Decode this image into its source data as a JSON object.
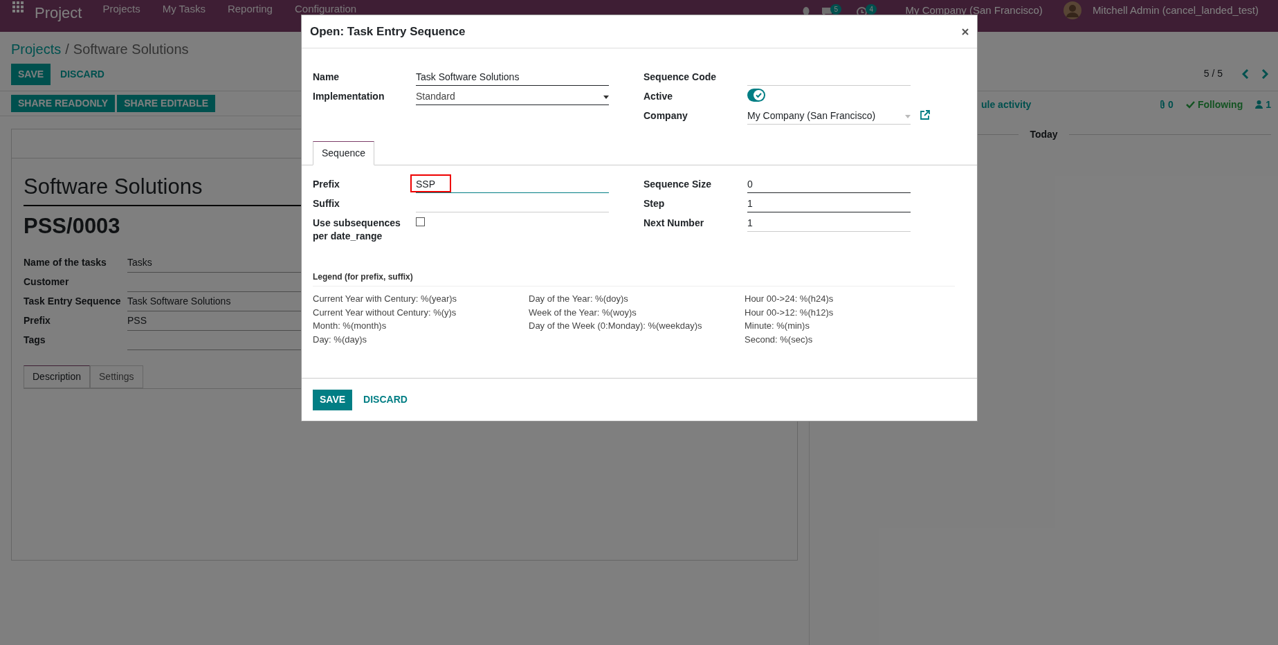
{
  "navbar": {
    "app_title": "Project",
    "menus": [
      "Projects",
      "My Tasks",
      "Reporting",
      "Configuration"
    ],
    "notifications": [
      {
        "kind": "chat",
        "count": "5"
      },
      {
        "kind": "activity",
        "count": "4"
      }
    ],
    "company": "My Company (San Francisco)",
    "user": "Mitchell Admin (cancel_landed_test)"
  },
  "breadcrumb": {
    "parent": "Projects",
    "separator": "/",
    "current": "Software Solutions"
  },
  "form_buttons": [
    "SAVE",
    "DISCARD"
  ],
  "share_buttons": [
    "SHARE READONLY",
    "SHARE EDITABLE"
  ],
  "pager": "5 / 5",
  "chatter": {
    "activity": "ule activity",
    "attachments": "0",
    "follow": "Following",
    "followers": "1",
    "date_separator": "Today"
  },
  "record": {
    "name": "Software Solutions",
    "code": "PSS/0003",
    "fields": [
      {
        "label": "Name of the tasks",
        "value": "Tasks"
      },
      {
        "label": "Customer"
      },
      {
        "label": "Task Entry Sequence",
        "value": "Task Software Solutions"
      },
      {
        "label": "Prefix",
        "value": "PSS"
      },
      {
        "label": "Tags"
      }
    ],
    "tabs": [
      {
        "label": "Description",
        "selected": true
      },
      {
        "label": "Settings",
        "selected": false
      }
    ]
  },
  "modal": {
    "title": "Open: Task Entry Sequence",
    "fields_left": [
      {
        "kind": "text",
        "label": "Name",
        "value": "Task Software Solutions"
      },
      {
        "kind": "select",
        "label": "Implementation",
        "value": "Standard"
      }
    ],
    "fields_right": [
      {
        "kind": "text",
        "label": "Sequence Code"
      },
      {
        "kind": "toggle",
        "label": "Active",
        "on": true
      },
      {
        "kind": "many2one",
        "label": "Company",
        "value": "My Company (San Francisco)"
      }
    ],
    "tabs": [
      {
        "label": "Sequence",
        "selected": true
      }
    ],
    "seq_left": [
      {
        "kind": "text",
        "label": "Prefix",
        "value": "SSP",
        "focused": true,
        "highlighted": true
      },
      {
        "kind": "text",
        "label": "Suffix",
        "focused": false,
        "highlighted": false
      },
      {
        "kind": "checkbox",
        "label": "Use subsequences per date_range",
        "checked": false
      }
    ],
    "seq_right": [
      {
        "kind": "text",
        "label": "Sequence Size",
        "value": "0",
        "required": true
      },
      {
        "kind": "text",
        "label": "Step",
        "value": "1",
        "required": true
      },
      {
        "kind": "text",
        "label": "Next Number",
        "value": "1",
        "required": false
      }
    ],
    "legend": {
      "title": "Legend (for prefix, suffix)",
      "columns": [
        [
          "Current Year with Century: %(year)s",
          "Current Year without Century: %(y)s",
          "Month: %(month)s",
          "Day: %(day)s"
        ],
        [
          "Day of the Year: %(doy)s",
          "Week of the Year: %(woy)s",
          "Day of the Week (0:Monday): %(weekday)s"
        ],
        [
          "Hour 00->24: %(h24)s",
          "Hour 00->12: %(h12)s",
          "Minute: %(min)s",
          "Second: %(sec)s"
        ]
      ]
    },
    "buttons": [
      "SAVE",
      "DISCARD"
    ]
  }
}
